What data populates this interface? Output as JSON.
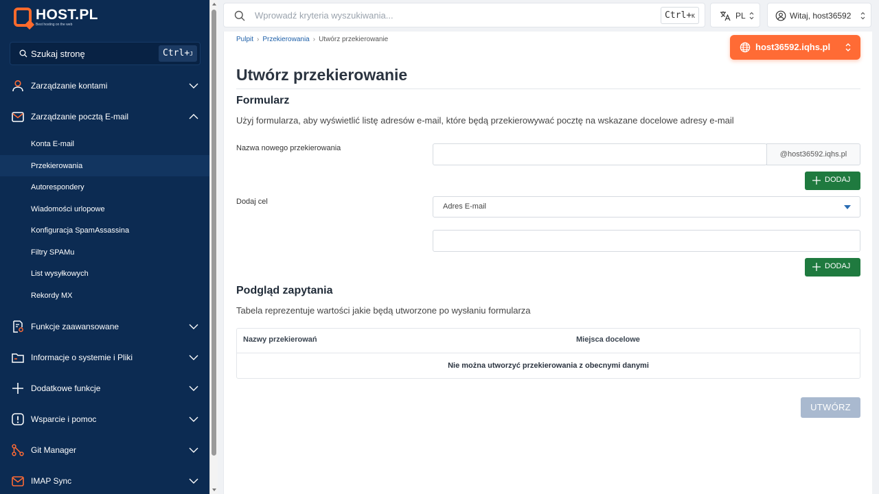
{
  "brand": {
    "name": "HOST.PL",
    "tagline": "Best hosting on the web"
  },
  "sidebar": {
    "search": {
      "label": "Szukaj stronę",
      "shortcut": "Ctrl+",
      "shortcut_key": "J"
    },
    "items": [
      {
        "label": "Zarządzanie kontami",
        "icon": "user-icon",
        "expanded": false
      },
      {
        "label": "Zarządzanie pocztą E-mail",
        "icon": "mail-icon",
        "expanded": true
      },
      {
        "label": "Funkcje zaawansowane",
        "icon": "advanced-settings-icon",
        "expanded": false
      },
      {
        "label": "Informacje o systemie i Pliki",
        "icon": "folder-icon",
        "expanded": false
      },
      {
        "label": "Dodatkowe funkcje",
        "icon": "plus-icon",
        "expanded": false
      },
      {
        "label": "Wsparcie i pomoc",
        "icon": "alert-icon",
        "expanded": false
      },
      {
        "label": "Git Manager",
        "icon": "git-icon",
        "expanded": false
      },
      {
        "label": "IMAP Sync",
        "icon": "mail-sync-icon",
        "expanded": false
      }
    ],
    "subitems": [
      {
        "label": "Konta E-mail"
      },
      {
        "label": "Przekierowania",
        "active": true
      },
      {
        "label": "Autorespondery"
      },
      {
        "label": "Wiadomości urlopowe"
      },
      {
        "label": "Konfiguracja SpamAssassina"
      },
      {
        "label": "Filtry SPAMu"
      },
      {
        "label": "List wysyłkowych"
      },
      {
        "label": "Rekordy MX"
      }
    ]
  },
  "topbar": {
    "search_placeholder": "Wprowadź kryteria wyszukiwania...",
    "shortcut": "Ctrl+",
    "shortcut_key": "K",
    "language": "PL",
    "user_greeting": "Witaj, host36592"
  },
  "breadcrumb": [
    "Pulpit",
    "Przekierowania",
    "Utwórz przekierowanie"
  ],
  "domain_selector": "host36592.iqhs.pl",
  "page": {
    "title": "Utwórz przekierowanie",
    "form_heading": "Formularz",
    "form_description": "Użyj formularza, aby wyświetlić listę adresów e-mail, które będą przekierowywać pocztę na wskazane docelowe adresy e-mail",
    "name_label": "Nazwa nowego przekierowania",
    "name_value": "",
    "domain_suffix": "@host36592.iqhs.pl",
    "add_label": "DODAJ",
    "target_label": "Dodaj cel",
    "target_type": "Adres E-mail",
    "target_value": "",
    "preview_heading": "Podgląd zapytania",
    "preview_description": "Tabela reprezentuje wartości jakie będą utworzone po wysłaniu formularza",
    "table_headers": [
      "Nazwy przekierowań",
      "Miejsca docelowe"
    ],
    "table_empty": "Nie można utworzyć przekierowania z obecnymi danymi",
    "create_label": "UTWÓRZ"
  },
  "colors": {
    "sidebar": "#0c2b52",
    "accent": "#ff6b35",
    "success": "#1f7a3f",
    "disabled": "#a9b9cf"
  }
}
